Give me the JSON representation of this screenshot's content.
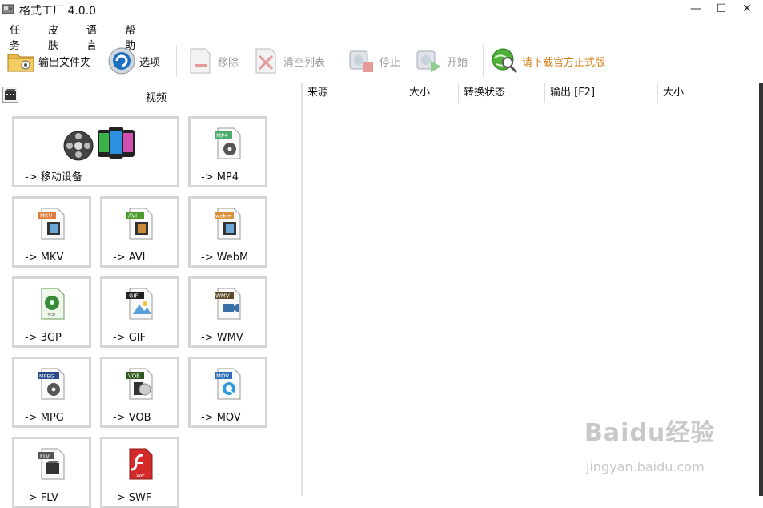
{
  "window": {
    "title": "格式工厂 4.0.0",
    "minimize": "—",
    "maximize": "☐",
    "close": "✕"
  },
  "menu": [
    "任务",
    "皮肤",
    "语言",
    "帮助"
  ],
  "toolbar": {
    "output_folder": "输出文件夹",
    "options": "选项",
    "remove": "移除",
    "clear_list": "清空列表",
    "stop": "停止",
    "start": "开始",
    "download_official": "请下载官方正式版",
    "download_color": "#d4801a"
  },
  "category": {
    "title": "视频"
  },
  "tiles": [
    {
      "label": "-> 移动设备",
      "badge": ""
    },
    {
      "label": "-> MP4",
      "badge": "MP4"
    },
    {
      "label": "-> MKV",
      "badge": "MKV"
    },
    {
      "label": "-> AVI",
      "badge": "AVI"
    },
    {
      "label": "-> WebM",
      "badge": "webm"
    },
    {
      "label": "-> 3GP",
      "badge": "3GP"
    },
    {
      "label": "-> GIF",
      "badge": "GIF"
    },
    {
      "label": "-> WMV",
      "badge": "WMV"
    },
    {
      "label": "-> MPG",
      "badge": "MPEG"
    },
    {
      "label": "-> VOB",
      "badge": "VOB"
    },
    {
      "label": "-> MOV",
      "badge": "MOV"
    },
    {
      "label": "-> FLV",
      "badge": "FLV"
    },
    {
      "label": "-> SWF",
      "badge": "SWF"
    }
  ],
  "table": {
    "columns": [
      "来源",
      "大小",
      "转换状态",
      "输出 [F2]",
      "大小"
    ]
  },
  "watermark": {
    "brand": "Baidu经验",
    "url": "jingyan.baidu.com"
  }
}
